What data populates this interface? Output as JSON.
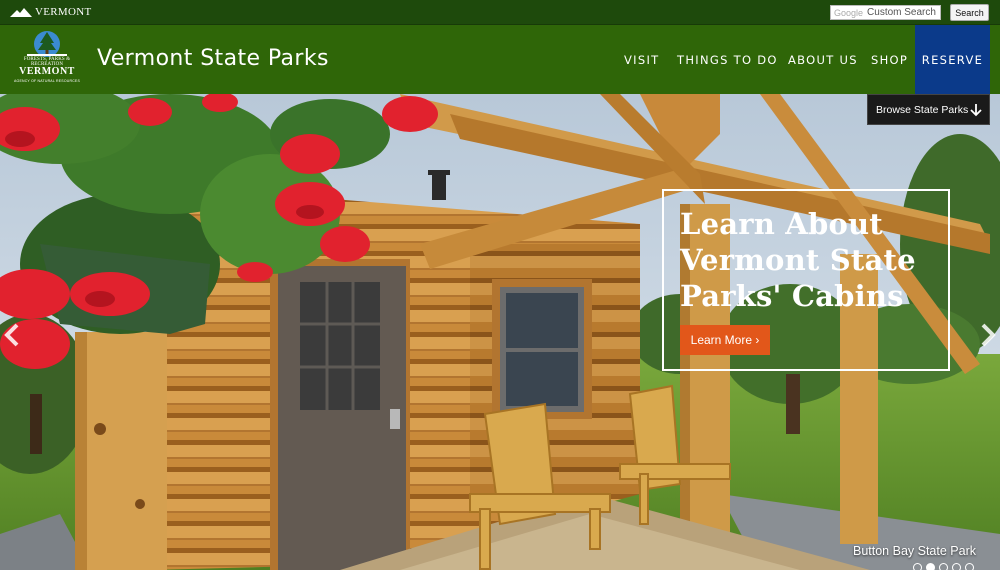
{
  "topbar": {
    "brand": "VERMONT",
    "search": {
      "google_label": "Google",
      "placeholder": "Custom Search"
    },
    "search_button": "Search"
  },
  "header": {
    "logo": {
      "line1": "FORESTS, PARKS & RECREATION",
      "line2": "VERMONT",
      "line3": "AGENCY OF NATURAL RESOURCES"
    },
    "title": "Vermont State Parks",
    "nav": [
      "VISIT",
      "THINGS TO DO",
      "ABOUT US",
      "SHOP"
    ],
    "reserve": "RESERVE",
    "colors": {
      "header_green": "#2f6608",
      "topbar_green": "#1e4a0c",
      "reserve_blue": "#0b3a8a"
    }
  },
  "hero": {
    "browse": "Browse State Parks",
    "caption_title": "Learn About Vermont State Parks' Cabins",
    "learn_more": "Learn More ›",
    "park_name": "Button Bay State Park",
    "slide_count": 5,
    "active_slide": 1,
    "button_color": "#e2571a"
  }
}
